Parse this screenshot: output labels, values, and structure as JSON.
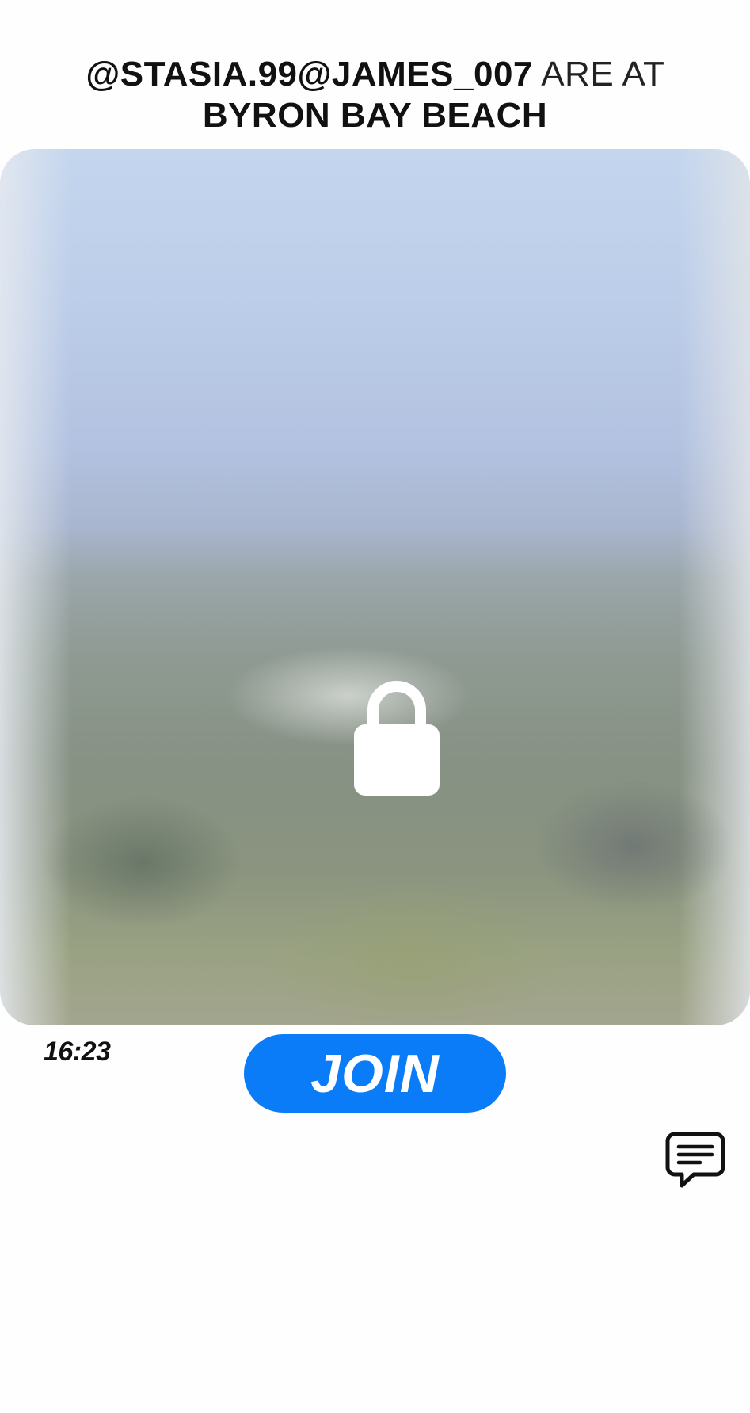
{
  "header": {
    "users": "@STASIA.99@JAMES_007",
    "connector": "ARE AT",
    "location": "BYRON BAY BEACH"
  },
  "photo": {
    "state": "locked",
    "icon": "lock-icon"
  },
  "post": {
    "time": "16:23"
  },
  "actions": {
    "join_label": "JOIN",
    "chat_icon": "chat-bubble-icon"
  },
  "colors": {
    "accent": "#0a7cf8",
    "text": "#111111",
    "background": "#fefefe"
  }
}
